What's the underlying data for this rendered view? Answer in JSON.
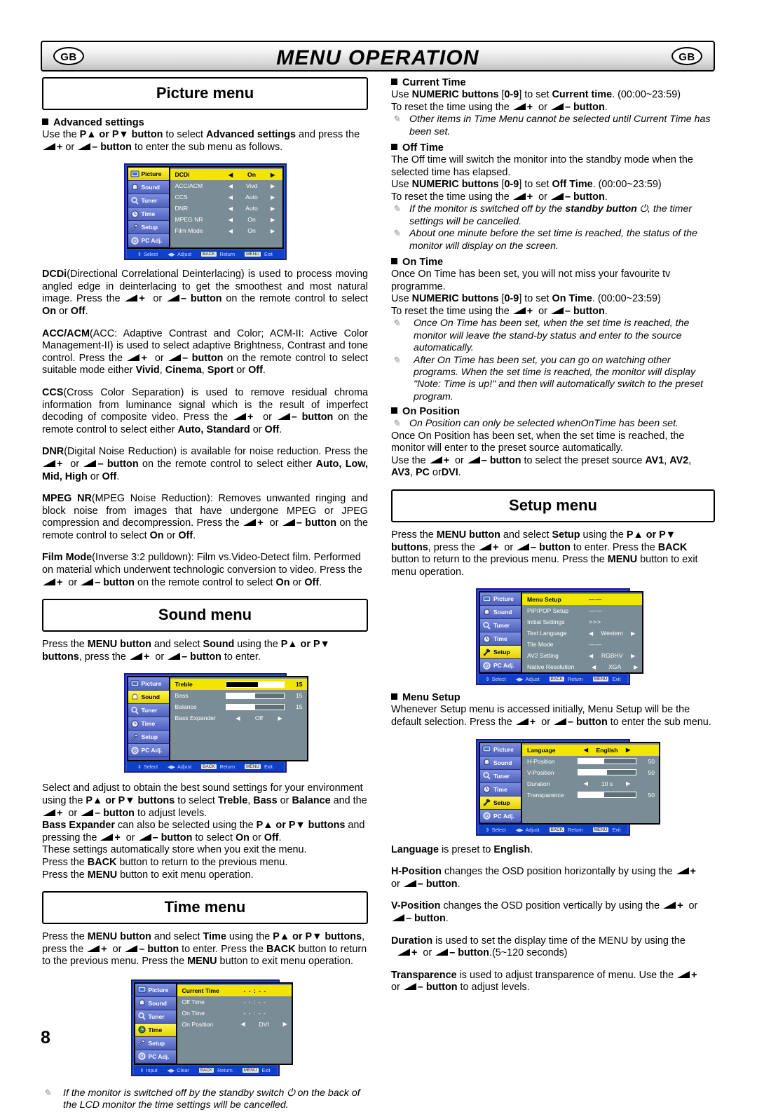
{
  "header": {
    "title": "MENU OPERATION",
    "badge_left": "GB",
    "badge_right": "GB"
  },
  "page_number": "8",
  "picture_menu": {
    "title": "Picture menu",
    "advanced_heading": "Advanced settings",
    "advanced_intro_a": "Use the ",
    "advanced_intro_b": "P▲",
    "advanced_intro_c": " or ",
    "advanced_intro_d": "P▼ button",
    "advanced_intro_e": " to select ",
    "advanced_intro_f": "Advanced settings",
    "advanced_intro_g": " and press the ",
    "advanced_intro_h": "+ ",
    "advanced_intro_i": "or ",
    "advanced_intro_j": "– button",
    "advanced_intro_k": " to enter the sub menu as follows.",
    "osd": {
      "sidebar": [
        "Picture",
        "Sound",
        "Tuner",
        "Time",
        "Setup",
        "PC Adj."
      ],
      "selected_sidebar": "Picture",
      "rows": [
        {
          "label": "DCDi",
          "value": "On",
          "selected": true
        },
        {
          "label": "ACC/ACM",
          "value": "Vivd",
          "selected": false
        },
        {
          "label": "CCS",
          "value": "Auto",
          "selected": false
        },
        {
          "label": "DNR",
          "value": "Auto",
          "selected": false
        },
        {
          "label": "MPEG NR",
          "value": "On",
          "selected": false
        },
        {
          "label": "Film Mode",
          "value": "On",
          "selected": false
        }
      ],
      "footer": [
        "Select",
        "Adjust",
        "BACK",
        "Return",
        "MENU",
        "Exit"
      ]
    },
    "dcdi_term": "DCDi",
    "dcdi_text_1": "(Directional Correlational Deinterlacing) is used to process moving angled edge in deinterlacing to get the smoothest and most natural image. Press the ",
    "dcdi_text_2": " on the remote control to select ",
    "dcdi_on": "On",
    "dcdi_or": " or ",
    "dcdi_off": "Off",
    "accacm_term": "ACC/ACM",
    "accacm_text_1": "(ACC: Adaptive Contrast and Color; ACM-II: Active Color Management-II) is used to select adaptive Brightness, Contrast and tone control. Press the ",
    "accacm_text_2": " on the remote control to select suitable mode either ",
    "accacm_opts": [
      "Vivid",
      "Cinema",
      "Sport",
      "Off"
    ],
    "ccs_term": "CCS",
    "ccs_text_1": "(Cross Color Separation) is used to remove residual chroma information from luminance signal which is the result of imperfect decoding of composite video. Press the ",
    "ccs_text_2": " on the remote control to select either ",
    "ccs_opts_a": "Auto, Standard",
    "ccs_opts_b": "Off",
    "dnr_term": "DNR",
    "dnr_text_1": "(Digital Noise Reduction) is available for noise reduction. Press the ",
    "dnr_text_2": " on the remote control to select either ",
    "dnr_opts_a": "Auto, Low, Mid, High",
    "dnr_opts_b": "Off",
    "mpegnr_term": "MPEG NR",
    "mpegnr_text_1": "(MPEG Noise Reduction): Removes unwanted ringing and block noise from images that have undergone MPEG or JPEG compression and decompression. Press the ",
    "mpegnr_text_2": " on the remote control to select ",
    "filmmode_term": "Film Mode",
    "filmmode_text_1": "(Inverse 3:2 pulldown): Film vs.Video-Detect film. Performed on material which underwent technologic conversion to video. Press the ",
    "filmmode_text_2": " on the remote control to select ",
    "button_word": "button"
  },
  "sound_menu": {
    "title": "Sound menu",
    "intro_1": "Press the ",
    "intro_menu": "MENU button",
    "intro_2": " and select ",
    "intro_sound": "Sound",
    "intro_3": " using the ",
    "intro_pup": "P▲",
    "intro_4": " or ",
    "intro_pdn": "P▼ buttons",
    "intro_5": ", press the ",
    "intro_6": " to enter.",
    "osd": {
      "sidebar": [
        "Picture",
        "Sound",
        "Tuner",
        "Time",
        "Setup",
        "PC Adj."
      ],
      "selected_sidebar": "Sound",
      "rows": [
        {
          "label": "Treble",
          "type": "bar",
          "value": "15",
          "fill": 55,
          "selected": true
        },
        {
          "label": "Bass",
          "type": "bar",
          "value": "15",
          "fill": 50,
          "selected": false
        },
        {
          "label": "Balance",
          "type": "bar",
          "value": "15",
          "fill": 50,
          "selected": false
        },
        {
          "label": "Bass Expander",
          "type": "opt",
          "value": "Off",
          "selected": false
        }
      ],
      "footer": [
        "Select",
        "Adjust",
        "BACK",
        "Return",
        "MENU",
        "Exit"
      ]
    },
    "body_1": "Select and adjust to obtain the best sound settings for your environment using the ",
    "body_2": " to select ",
    "body_treble": "Treble",
    "body_bass": "Bass",
    "body_balance": "Balance",
    "body_3": " and the ",
    "body_4": " to adjust levels.",
    "body_expander": "Bass Expander",
    "body_5": " can also be selected using the ",
    "body_6": " and pressing the ",
    "body_7": " to select ",
    "body_on": "On",
    "body_off": "Off",
    "body_8": "These settings automatically store when you exit the menu.",
    "body_9a": "Press the ",
    "body_back": "BACK",
    "body_9b": " button to return to the previous menu.",
    "body_10a": "Press the ",
    "body_menu": "MENU",
    "body_10b": " button to exit menu operation."
  },
  "time_menu": {
    "title": "Time menu",
    "intro_1": "Press the ",
    "intro_menu": "MENU button",
    "intro_2": " and select ",
    "intro_time": "Time",
    "intro_3": " using the ",
    "intro_pup": "P▲",
    "intro_4": " or ",
    "intro_pdn": "P▼ buttons",
    "intro_5": ", press the ",
    "intro_6": " to enter. Press the ",
    "intro_back": "BACK",
    "intro_7": " button to return to the previous menu. Press the ",
    "intro_menu2": "MENU",
    "intro_8": " button to exit menu operation.",
    "osd": {
      "sidebar": [
        "Picture",
        "Sound",
        "Tuner",
        "Time",
        "Setup",
        "PC Adj."
      ],
      "selected_sidebar": "Time",
      "rows": [
        {
          "label": "Current Time",
          "value": "- - : - -",
          "selected": true
        },
        {
          "label": "Off Time",
          "value": "- - : - -",
          "selected": false
        },
        {
          "label": "On Time",
          "value": "- - : - -",
          "selected": false
        },
        {
          "label": "On Position",
          "value": "DVI",
          "selected": false,
          "type": "opt"
        }
      ],
      "footer": [
        "Input",
        "Clear",
        "BACK",
        "Return",
        "MENU",
        "Exit"
      ]
    },
    "note": "If the monitor is switched off by the standby switch ⏻ on the back of the LCD monitor the time settings will be cancelled."
  },
  "right_column": {
    "current_time": {
      "heading": "Current Time",
      "line1_a": "Use ",
      "line1_b": "NUMERIC buttons",
      "line1_c": " [",
      "line1_d": "0-9",
      "line1_e": "] to set ",
      "line1_f": "Current time",
      "line1_g": ". (00:00~23:59)",
      "line2_a": "To reset the time using the ",
      "line2_b": ".",
      "note1": "Other items in Time Menu cannot be selected until Current Time has been set."
    },
    "off_time": {
      "heading": "Off Time",
      "para": "The Off time will switch the monitor into the standby mode when the selected time has elapsed.",
      "line1_f": "Off Time",
      "note_a": "If the monitor is switched off by the ",
      "note_b": "standby button",
      "note_c": " ⏻,  the timer settings will be cancelled.",
      "note2": "About one minute before the set time is reached, the status of the monitor will display on the screen."
    },
    "on_time": {
      "heading": "On Time",
      "para": "Once On Time has been set, you will not miss your favourite tv programme.",
      "line1_f": "On Time",
      "note1": "Once On Time has been set, when the set time is reached, the monitor will leave the stand-by status and enter to the source automatically.",
      "note2": "After On Time has been set, you can go on watching other programs. When the set time is reached, the monitor will display \"Note: Time is up!\" and then will automatically switch to the preset program."
    },
    "on_position": {
      "heading": "On Position",
      "note1": "On Position can only be selected whenOnTime has been set.",
      "para": "Once On Position has been set, when the set time is reached, the monitor will enter to the preset source automatically.",
      "use_a": "Use the ",
      "use_b": " to select  the preset source ",
      "sources_a": "AV1",
      "sources_b": "AV2",
      "sources_c": "AV3",
      "sources_d": "PC",
      "sources_e": " or",
      "sources_f": "DVI",
      "period": "."
    }
  },
  "setup_menu": {
    "title": "Setup menu",
    "intro_1": "Press the ",
    "intro_menu": "MENU button",
    "intro_2": " and select ",
    "intro_setup": "Setup",
    "intro_3": " using the ",
    "intro_pup": "P▲",
    "intro_4": " or ",
    "intro_pdn": "P▼ buttons",
    "intro_5": ", press the ",
    "intro_6": " to enter. Press the ",
    "intro_back": "BACK",
    "intro_7": " button to return to the previous menu. Press the ",
    "intro_menu2": "MENU",
    "intro_8": " button to exit menu operation.",
    "osd": {
      "sidebar": [
        "Picture",
        "Sound",
        "Tuner",
        "Time",
        "Setup",
        "PC Adj."
      ],
      "selected_sidebar": "Setup",
      "rows": [
        {
          "label": "Menu Setup",
          "value": "——",
          "selected": true,
          "type": "dash"
        },
        {
          "label": "PIP/POP Setup",
          "value": "——",
          "selected": false,
          "type": "dash"
        },
        {
          "label": "Initial Settings",
          "value": ">>>",
          "selected": false,
          "type": "dash"
        },
        {
          "label": "Text Language",
          "value": "Western",
          "selected": false,
          "type": "opt"
        },
        {
          "label": "Tile Mode",
          "value": "——",
          "selected": false,
          "type": "dash"
        },
        {
          "label": "AV2 Setting",
          "value": "RGBHV",
          "selected": false,
          "type": "opt"
        },
        {
          "label": "Native Resolution",
          "value": "XGA",
          "selected": false,
          "type": "opt"
        }
      ],
      "footer": [
        "Select",
        "Adjust",
        "BACK",
        "Return",
        "MENU",
        "Exit"
      ]
    },
    "menu_setup_heading": "Menu Setup",
    "menu_setup_1": "Whenever Setup menu is accessed initially, Menu Setup will be the default selection. Press the ",
    "menu_setup_2": " to enter the sub menu.",
    "osd2": {
      "sidebar": [
        "Picture",
        "Sound",
        "Tuner",
        "Time",
        "Setup",
        "PC Adj."
      ],
      "selected_sidebar": "Setup",
      "rows": [
        {
          "label": "Language",
          "value": "English",
          "selected": true,
          "type": "opt"
        },
        {
          "label": "H-Position",
          "value": "50",
          "fill": 55,
          "selected": false,
          "type": "bar"
        },
        {
          "label": "V-Position",
          "value": "50",
          "fill": 50,
          "selected": false,
          "type": "bar"
        },
        {
          "label": "Duration",
          "value": "10 s",
          "selected": false,
          "type": "opt"
        },
        {
          "label": "Transparence",
          "value": "50",
          "fill": 55,
          "selected": false,
          "type": "bar"
        }
      ],
      "footer": [
        "Select",
        "Adjust",
        "BACK",
        "Return",
        "MENU",
        "Exit"
      ]
    },
    "lang_term": "Language",
    "lang_text": " is preset to ",
    "lang_value": "English",
    "hpos_term": "H-Position",
    "hpos_text_1": " changes the OSD position horizontally by using the ",
    "vpos_term": "V-Position",
    "vpos_text_1": " changes the OSD position vertically by using the ",
    "dur_term": "Duration",
    "dur_text_1": " is used to set the display time of the MENU by using the ",
    "dur_text_2": ".(5~120 seconds)",
    "trans_term": "Transparence",
    "trans_text_1": " is used to adjust transparence of menu. Use the ",
    "trans_text_2": " to adjust levels.",
    "or_word": "or ",
    "button_word": "button"
  },
  "colors": {
    "osd_blue": "#2b55c8",
    "osd_panel": "#7a8d96",
    "osd_highlight": "#f2e500",
    "osd_sidebar": "#5f72c9"
  }
}
